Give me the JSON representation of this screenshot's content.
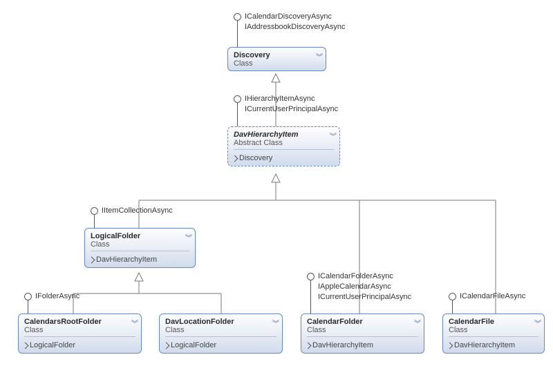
{
  "discovery": {
    "title": "Discovery",
    "kind": "Class",
    "iface1": "ICalendarDiscoveryAsync",
    "iface2": "IAddressbookDiscoveryAsync"
  },
  "davhier": {
    "title": "DavHierarchyItem",
    "kind": "Abstract Class",
    "inherit": "Discovery",
    "iface1": "IHierarchyItemAsync",
    "iface2": "ICurrentUserPrincipalAsync"
  },
  "logical": {
    "title": "LogicalFolder",
    "kind": "Class",
    "inherit": "DavHierarchyItem",
    "iface1": "IItemCollectionAsync"
  },
  "calroot": {
    "title": "CalendarsRootFolder",
    "kind": "Class",
    "inherit": "LogicalFolder",
    "iface1": "IFolderAsync"
  },
  "davloc": {
    "title": "DavLocationFolder",
    "kind": "Class",
    "inherit": "LogicalFolder"
  },
  "calfolder": {
    "title": "CalendarFolder",
    "kind": "Class",
    "inherit": "DavHierarchyItem",
    "iface1": "ICalendarFolderAsync",
    "iface2": "IAppleCalendarAsync",
    "iface3": "ICurrentUserPrincipalAsync"
  },
  "calfile": {
    "title": "CalendarFile",
    "kind": "Class",
    "inherit": "DavHierarchyItem",
    "iface1": "ICalendarFileAsync"
  }
}
